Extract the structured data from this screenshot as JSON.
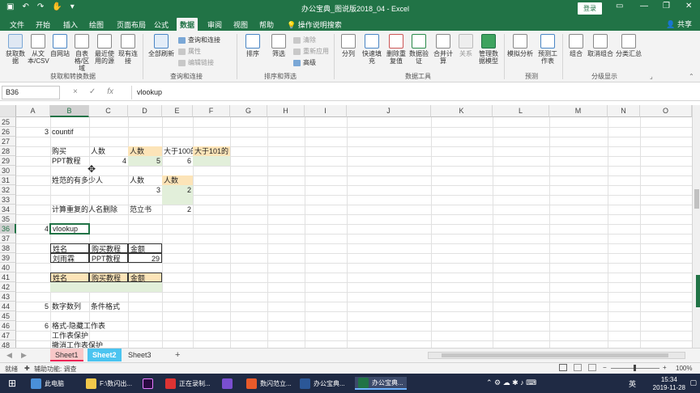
{
  "titlebar": {
    "title": "办公宝典_图说版2018_04 - Excel",
    "login": "登录",
    "qa_icons": [
      "save-icon",
      "undo-icon",
      "redo-icon",
      "touch-icon",
      "customize-icon"
    ],
    "window_controls": [
      "restore-ribbon-icon",
      "minimize-icon",
      "maximize-icon",
      "close-icon"
    ]
  },
  "tabs": [
    "文件",
    "开始",
    "插入",
    "绘图",
    "页面布局",
    "公式",
    "数据",
    "审阅",
    "视图",
    "帮助",
    "操作说明搜索"
  ],
  "active_tab": "数据",
  "share": "共享",
  "ribbon": {
    "get_external": [
      "获取数据",
      "从文本/CSV",
      "自网站",
      "自表格/区域",
      "最近使用的源",
      "现有连接"
    ],
    "group1_label": "获取和转换数据",
    "refresh": "全部刷新",
    "queries": [
      "查询和连接",
      "属性",
      "编辑链接"
    ],
    "group2_label": "查询和连接",
    "sort_filter": [
      "排序",
      "筛选"
    ],
    "sort_small": [
      "清除",
      "重新应用",
      "高级"
    ],
    "group3_label": "排序和筛选",
    "tools": [
      "分列",
      "快速填充",
      "删除重复值",
      "数据验证",
      "合并计算",
      "关系",
      "管理数据模型"
    ],
    "group4_label": "数据工具",
    "forecast": [
      "模拟分析",
      "预测工作表"
    ],
    "group5_label": "预测",
    "outline": [
      "组合",
      "取消组合",
      "分类汇总"
    ],
    "group6_label": "分级显示"
  },
  "formula_bar": {
    "name_box": "B36",
    "cancel": "×",
    "enter": "✓",
    "fx": "fx",
    "content": "vlookup"
  },
  "columns": [
    "A",
    "B",
    "C",
    "D",
    "E",
    "F",
    "G",
    "H",
    "I",
    "J",
    "K",
    "L",
    "M",
    "N",
    "O"
  ],
  "rows": [
    "25",
    "26",
    "27",
    "28",
    "29",
    "30",
    "31",
    "32",
    "33",
    "34",
    "35",
    "36",
    "37",
    "38",
    "39",
    "40",
    "41",
    "42",
    "43",
    "44",
    "45",
    "46",
    "47",
    "48"
  ],
  "cells": {
    "a26": "3",
    "b26": "countif",
    "b28": "购买",
    "c28": "人数",
    "d28": "人数",
    "e28": "大于100的",
    "f28": "大于101的",
    "b29": "PPT教程",
    "c29": "4",
    "d29": "5",
    "e29": "6",
    "b31": "姓范的有多少人",
    "d31": "人数",
    "e31": "人数",
    "d32": "3",
    "e32": "2",
    "b34": "计算重复的人名删除",
    "d34": "范立书",
    "e34": "2",
    "a36": "4",
    "b36": "vlookup",
    "b38": "姓名",
    "c38": "购买教程",
    "d38": "金额",
    "b39": "刘雨霖",
    "c39": "PPT教程",
    "d39": "29",
    "b41": "姓名",
    "c41": "购买教程",
    "d41": "金额",
    "a44": "5",
    "b44": "数字数列",
    "c44": "条件格式",
    "a46": "6",
    "b46": "格式-隐藏工作表",
    "b47": "工作表保护",
    "b48": "撤消工作表保护"
  },
  "sheets": [
    "Sheet1",
    "Sheet2",
    "Sheet3"
  ],
  "add_sheet": "+",
  "status": {
    "ready": "就绪",
    "accessibility": "辅助功能: 调查",
    "zoom": "100%"
  },
  "taskbar": {
    "items": [
      "此电脑",
      "F:\\数闪出...",
      "",
      "正在录制...",
      "",
      "数闪范立...",
      "办公宝典...",
      "办公宝典..."
    ],
    "ime": "英",
    "time": "15:34",
    "date": "2019-11-28"
  }
}
